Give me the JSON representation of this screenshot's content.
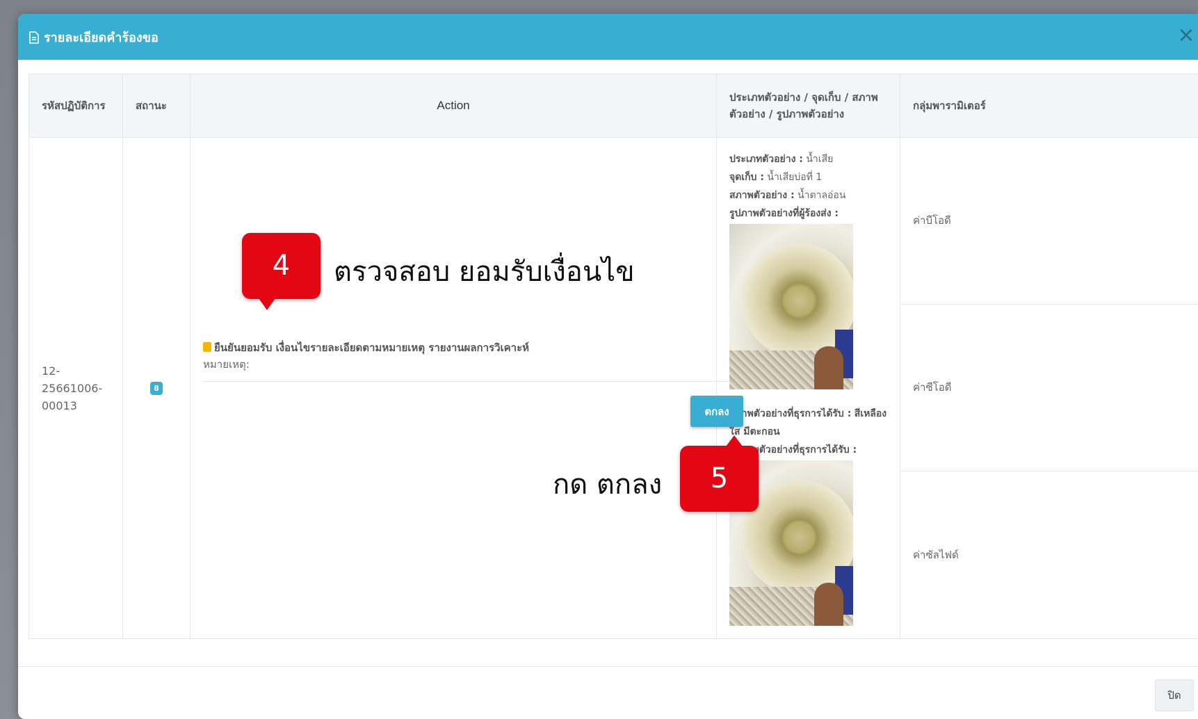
{
  "modal": {
    "title": "รายละเอียดคำร้องขอ",
    "close_icon": "×",
    "footer_close_label": "ปิด"
  },
  "table": {
    "headers": {
      "code": "รหัสปฏิบัติการ",
      "status": "สถานะ",
      "action": "Action",
      "sample": "ประเภทตัวอย่าง / จุดเก็บ / สภาพตัวอย่าง / รูปภาพตัวอย่าง",
      "params": "กลุ่มพารามิเตอร์"
    },
    "row": {
      "code": "12-25661006-00013",
      "status_badge": "8",
      "action": {
        "confirm_text": "ยืนยันยอมรับ เงื่อนไขรายละเอียดตามหมายเหตุ รายงานผลการวิเคาะห์",
        "note_label": "หมายเหตุ:",
        "ok_label": "ตกลง"
      },
      "sample": {
        "type_label": "ประเภทตัวอย่าง :",
        "type_value": "น้ำเสีย",
        "point_label": "จุดเก็บ :",
        "point_value": "น้ำเสียบ่อที่ 1",
        "condition_label": "สภาพตัวอย่าง :",
        "condition_value": "น้ำตาลอ่อน",
        "sender_photo_label": "รูปภาพตัวอย่างที่ผู้ร้องส่ง :",
        "received_condition_label": "สภาพตัวอย่างที่ธุรการได้รับ :",
        "received_condition_value": "สีเหลือง ใส มีตะกอน",
        "received_photo_label": "รูปภาพตัวอย่างที่ธุรการได้รับ :"
      },
      "params": [
        "ค่าบีโอดี",
        "ค่าซีโอดี",
        "ค่าซัลไฟด์"
      ]
    }
  },
  "annotations": {
    "step4_number": "4",
    "step4_text": "ตรวจสอบ ยอมรับเงื่อนไข",
    "step5_number": "5",
    "step5_text": "กด ตกลง"
  },
  "colors": {
    "header": "#38afd2",
    "callout": "#e30613"
  }
}
